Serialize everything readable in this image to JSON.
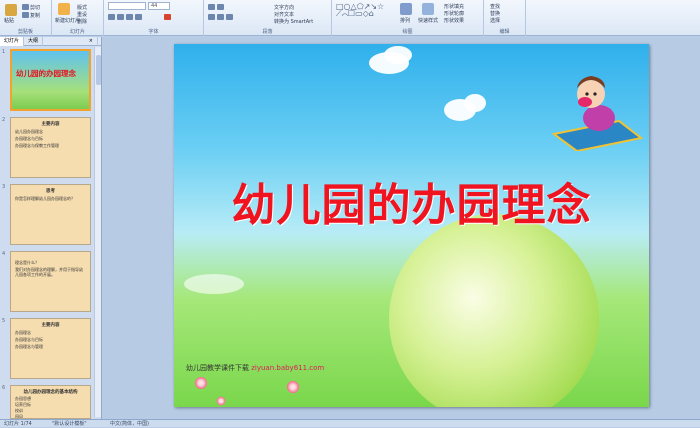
{
  "ribbon": {
    "groups": [
      {
        "label": "剪贴板",
        "buttons": [
          "粘贴",
          "剪切",
          "复制",
          "格式刷"
        ]
      },
      {
        "label": "幻灯片",
        "buttons": [
          "新建幻灯片",
          "版式",
          "重设",
          "删除"
        ]
      },
      {
        "label": "字体",
        "font_size": "44"
      },
      {
        "label": "段落",
        "buttons": [
          "文字方向",
          "对齐文本",
          "转换为 SmartArt"
        ]
      },
      {
        "label": "绘图",
        "buttons": [
          "排列",
          "快速样式",
          "形状填充",
          "形状轮廓",
          "形状效果"
        ]
      },
      {
        "label": "编辑",
        "buttons": [
          "查找",
          "替换",
          "选择"
        ]
      }
    ]
  },
  "panel": {
    "tabs": [
      "幻灯片",
      "大纲"
    ],
    "close": "×",
    "slides": [
      {
        "num": "1",
        "title": "幼儿园的办园理念"
      },
      {
        "num": "2",
        "title": "主要内容",
        "lines": [
          "幼儿园办园理念",
          "办园理念与目标",
          "办园理念与保教工作管理"
        ]
      },
      {
        "num": "3",
        "title": "思考",
        "lines": [
          "你是怎样理解幼儿园办园理念的？"
        ]
      },
      {
        "num": "4",
        "title": "",
        "lines": [
          "理念是什么？",
          "我们对办园理念的理解，并用于指导幼儿园各项工作的开展。"
        ]
      },
      {
        "num": "5",
        "title": "主要内容",
        "lines": [
          "办园理念",
          "办园理念与目标",
          "办园理念与管理"
        ]
      },
      {
        "num": "6",
        "title": "幼儿园办园理念的基本结构",
        "lines": [
          "办园思想",
          "培养目标",
          "校训",
          "园风"
        ]
      }
    ]
  },
  "slide": {
    "title": "幼儿园的办园理念",
    "footer_label": "幼儿园教学课件下载",
    "footer_url": "ziyuan.baby611.com"
  },
  "status": {
    "slide_count": "幻灯片 1/74",
    "theme": "\"默认设计模板\"",
    "language": "中文(简体，中国)"
  },
  "colors": {
    "title": "#f01320",
    "accent": "#f3a22c"
  }
}
